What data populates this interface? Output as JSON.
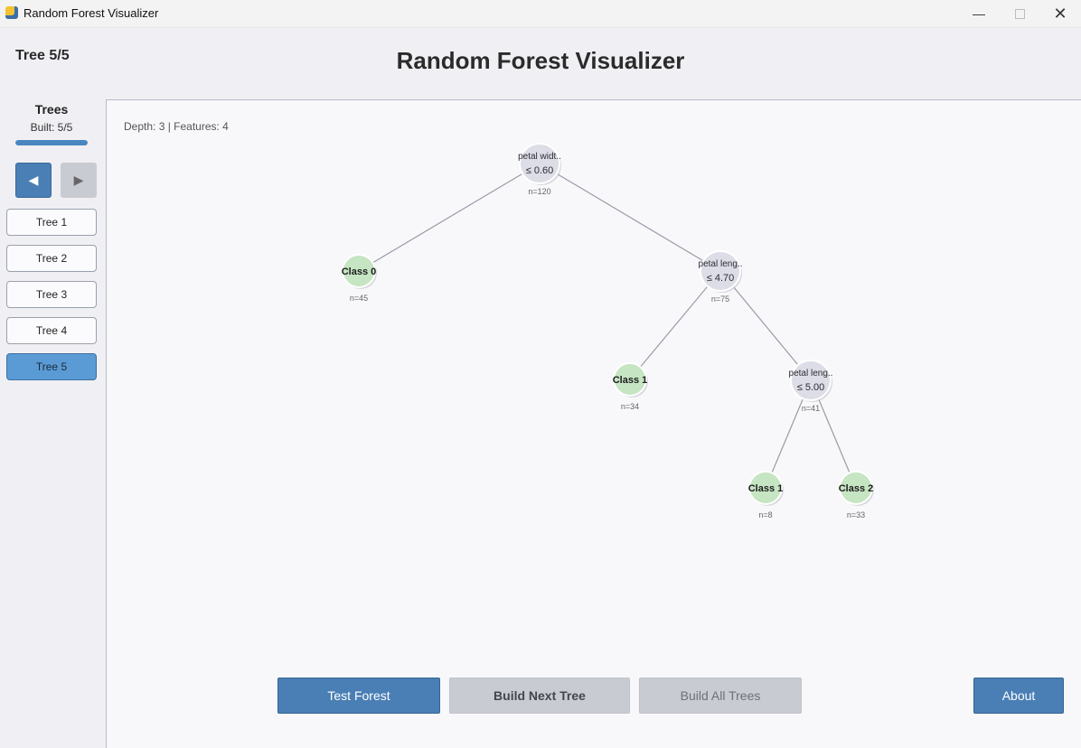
{
  "window": {
    "title": "Random Forest Visualizer",
    "min_glyph": "—",
    "close_glyph": "✕"
  },
  "header": {
    "tree_counter": "Tree 5/5",
    "title": "Random Forest Visualizer"
  },
  "sidebar": {
    "heading": "Trees",
    "built": "Built: 5/5",
    "progress": 1.0,
    "prev_glyph": "◀",
    "next_glyph": "▶",
    "items": [
      {
        "label": "Tree 1",
        "active": false
      },
      {
        "label": "Tree 2",
        "active": false
      },
      {
        "label": "Tree 3",
        "active": false
      },
      {
        "label": "Tree 4",
        "active": false
      },
      {
        "label": "Tree 5",
        "active": true
      }
    ]
  },
  "canvas": {
    "info": "Depth: 3 | Features: 4"
  },
  "tree": {
    "nodes": [
      {
        "id": "n0",
        "type": "split",
        "line1": "petal widt..",
        "line2": "≤ 0.60",
        "count": "n=120"
      },
      {
        "id": "n1",
        "type": "leaf",
        "line1": "Class 0",
        "count": "n=45"
      },
      {
        "id": "n2",
        "type": "split",
        "line1": "petal leng..",
        "line2": "≤ 4.70",
        "count": "n=75"
      },
      {
        "id": "n3",
        "type": "leaf",
        "line1": "Class 1",
        "count": "n=34"
      },
      {
        "id": "n4",
        "type": "split",
        "line1": "petal leng..",
        "line2": "≤ 5.00",
        "count": "n=41"
      },
      {
        "id": "n5",
        "type": "leaf",
        "line1": "Class 1",
        "count": "n=8"
      },
      {
        "id": "n6",
        "type": "leaf",
        "line1": "Class 2",
        "count": "n=33"
      }
    ],
    "edges": [
      [
        "n0",
        "n1"
      ],
      [
        "n0",
        "n2"
      ],
      [
        "n2",
        "n3"
      ],
      [
        "n2",
        "n4"
      ],
      [
        "n4",
        "n5"
      ],
      [
        "n4",
        "n6"
      ]
    ],
    "colors": {
      "split_fill": "#dcdde6",
      "leaf_fill": "#c6e5c2",
      "edge": "#9a9aa8"
    }
  },
  "buttons": {
    "test_forest": "Test Forest",
    "build_next": "Build Next Tree",
    "build_all": "Build All Trees",
    "about": "About"
  }
}
